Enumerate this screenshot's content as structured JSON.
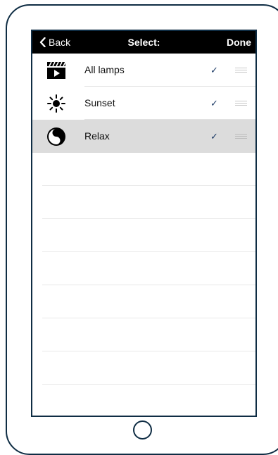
{
  "navbar": {
    "back_label": "Back",
    "title": "Select:",
    "done_label": "Done"
  },
  "rows": [
    {
      "label": "All lamps",
      "icon": "clapperboard-icon",
      "checked": true,
      "selected": false
    },
    {
      "label": "Sunset",
      "icon": "sun-icon",
      "checked": true,
      "selected": false
    },
    {
      "label": "Relax",
      "icon": "yin-yang-icon",
      "checked": true,
      "selected": true
    }
  ],
  "check_glyph": "✓",
  "colors": {
    "navbar_bg": "#000000",
    "selected_row_bg": "#dcdcdc",
    "checkmark": "#1d3b66",
    "device_frame": "#0f2d44"
  }
}
